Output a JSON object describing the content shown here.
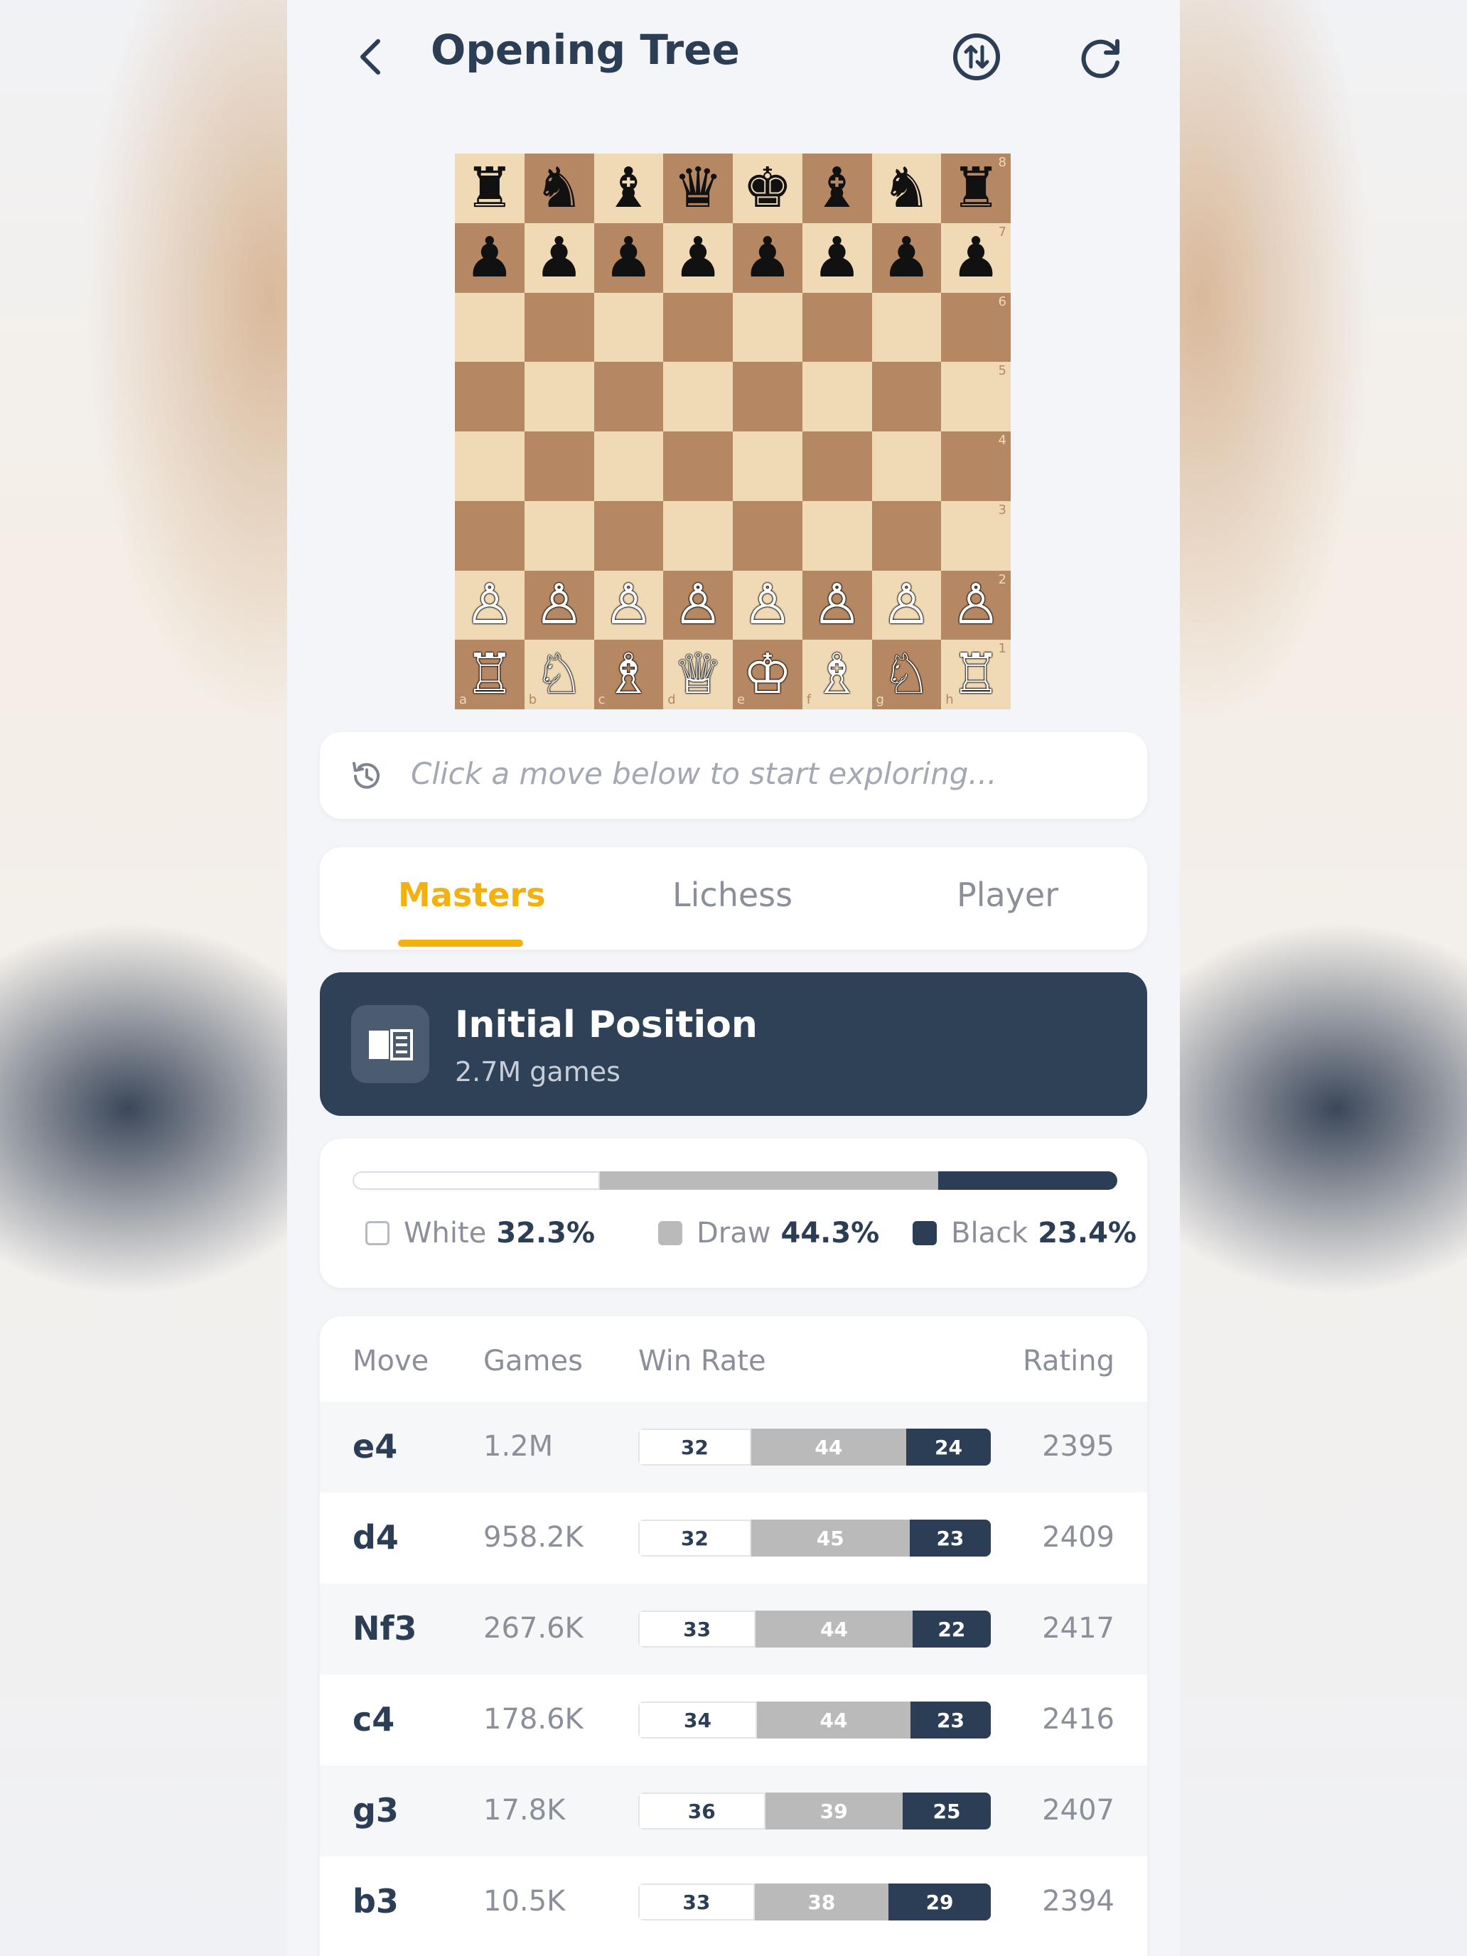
{
  "header": {
    "title": "Opening Tree",
    "back_icon": "chevron-left-icon",
    "flip_icon": "flip-board-icon",
    "refresh_icon": "refresh-icon"
  },
  "board": {
    "ranks": [
      "8",
      "7",
      "6",
      "5",
      "4",
      "3",
      "2",
      "1"
    ],
    "files": [
      "a",
      "b",
      "c",
      "d",
      "e",
      "f",
      "g",
      "h"
    ],
    "pieces": {
      "row8": [
        "♜",
        "♞",
        "♝",
        "♛",
        "♚",
        "♝",
        "♞",
        "♜"
      ],
      "row7": [
        "♟",
        "♟",
        "♟",
        "♟",
        "♟",
        "♟",
        "♟",
        "♟"
      ],
      "row2": [
        "♙",
        "♙",
        "♙",
        "♙",
        "♙",
        "♙",
        "♙",
        "♙"
      ],
      "row1": [
        "♖",
        "♘",
        "♗",
        "♕",
        "♔",
        "♗",
        "♘",
        "♖"
      ]
    },
    "colors": {
      "light": "#f0d9b5",
      "dark": "#b58863"
    }
  },
  "history": {
    "placeholder": "Click a move below to start exploring..."
  },
  "tabs": [
    {
      "label": "Masters",
      "active": true
    },
    {
      "label": "Lichess",
      "active": false
    },
    {
      "label": "Player",
      "active": false
    }
  ],
  "position": {
    "title": "Initial Position",
    "games": "2.7M games",
    "icon": "book-icon"
  },
  "results": {
    "white_label": "White",
    "white_value": "32.3%",
    "draw_label": "Draw",
    "draw_value": "44.3%",
    "black_label": "Black",
    "black_value": "23.4%",
    "white_pct": 32.3,
    "draw_pct": 44.3,
    "black_pct": 23.4
  },
  "table": {
    "headers": {
      "move": "Move",
      "games": "Games",
      "winrate": "Win Rate",
      "rating": "Rating"
    },
    "rows": [
      {
        "move": "e4",
        "games": "1.2M",
        "w": "32",
        "d": "44",
        "b": "24",
        "rating": "2395"
      },
      {
        "move": "d4",
        "games": "958.2K",
        "w": "32",
        "d": "45",
        "b": "23",
        "rating": "2409"
      },
      {
        "move": "Nf3",
        "games": "267.6K",
        "w": "33",
        "d": "44",
        "b": "22",
        "rating": "2417"
      },
      {
        "move": "c4",
        "games": "178.6K",
        "w": "34",
        "d": "44",
        "b": "23",
        "rating": "2416"
      },
      {
        "move": "g3",
        "games": "17.8K",
        "w": "36",
        "d": "39",
        "b": "25",
        "rating": "2407"
      },
      {
        "move": "b3",
        "games": "10.5K",
        "w": "33",
        "d": "38",
        "b": "29",
        "rating": "2394"
      }
    ]
  },
  "colors": {
    "accent": "#f2b10d",
    "navy": "#2f4157",
    "draw": "#bababa"
  }
}
